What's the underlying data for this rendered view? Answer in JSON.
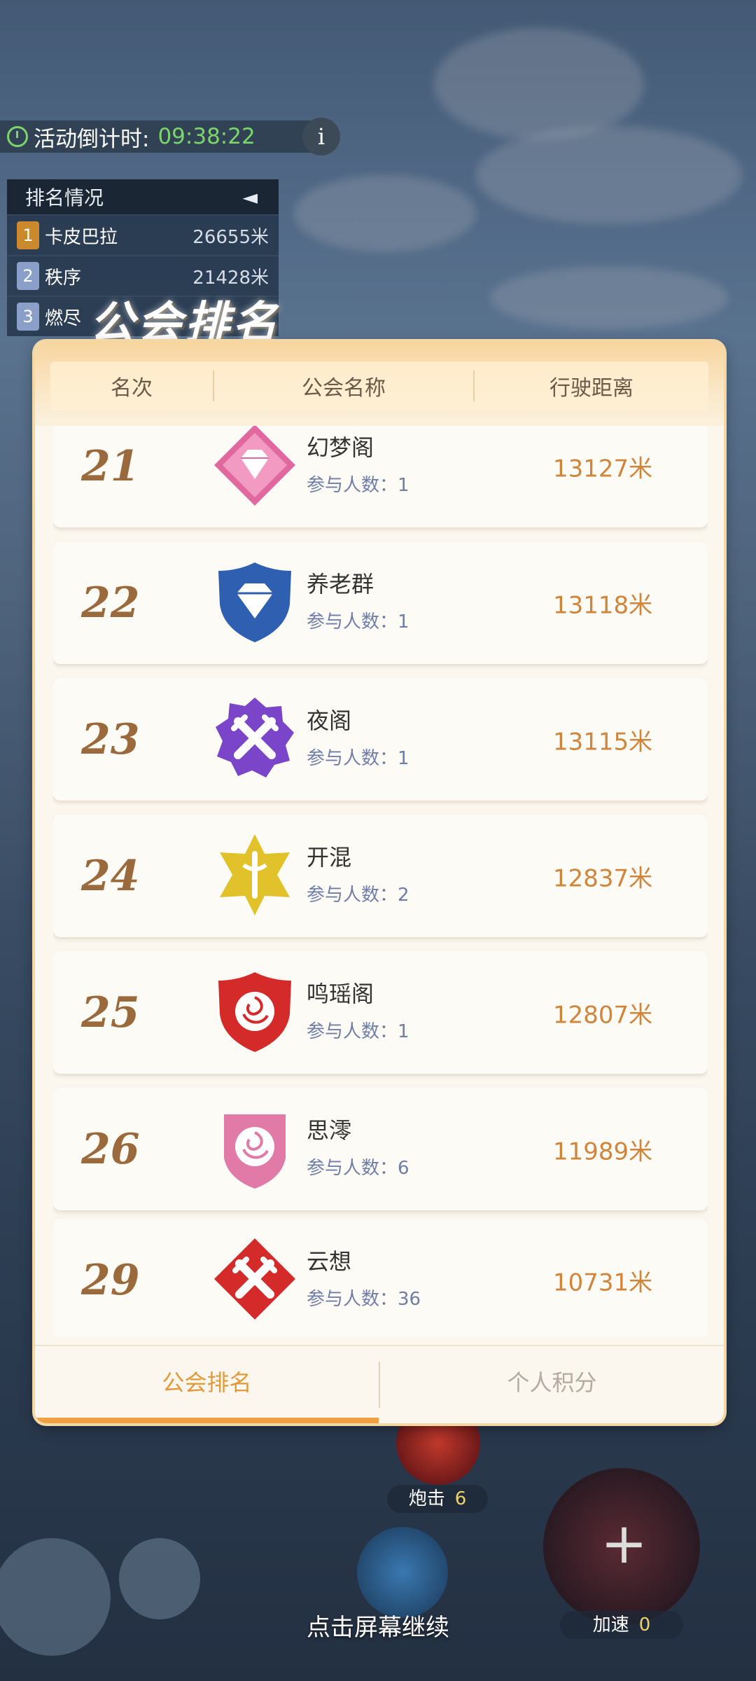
{
  "hud": {
    "countdown_label": "活动倒计时:",
    "countdown_time": "09:38:22",
    "info_glyph": "i",
    "rank_panel_title": "排名情况",
    "rank_panel_toggle": "◄",
    "rank_rows": [
      {
        "num": "1",
        "name": "卡皮巴拉",
        "dist": "26655米"
      },
      {
        "num": "2",
        "name": "秩序",
        "dist": "21428米"
      },
      {
        "num": "3",
        "name": "燃尽",
        "dist": ""
      }
    ]
  },
  "panel": {
    "title": "公会排名",
    "columns": [
      "名次",
      "公会名称",
      "行驶距离"
    ],
    "members_prefix": "参与人数：",
    "rows": [
      {
        "rank": "21",
        "name": "幻梦阁",
        "members": "1",
        "distance": "13127米",
        "badge_icon": "pink-diamond-badge",
        "badge_color": "#e06aa0"
      },
      {
        "rank": "22",
        "name": "养老群",
        "members": "1",
        "distance": "13118米",
        "badge_icon": "blue-shield-diamond-badge",
        "badge_color": "#2f5fb0"
      },
      {
        "rank": "23",
        "name": "夜阁",
        "members": "1",
        "distance": "13115米",
        "badge_icon": "purple-crossed-swords-badge",
        "badge_color": "#7a45c8"
      },
      {
        "rank": "24",
        "name": "开混",
        "members": "2",
        "distance": "12837米",
        "badge_icon": "gold-star-sword-badge",
        "badge_color": "#e2c22a"
      },
      {
        "rank": "25",
        "name": "鸣瑶阁",
        "members": "1",
        "distance": "12807米",
        "badge_icon": "red-rose-shield-badge",
        "badge_color": "#d42a2a"
      },
      {
        "rank": "26",
        "name": "思澪",
        "members": "6",
        "distance": "11989米",
        "badge_icon": "pink-rose-badge",
        "badge_color": "#e27aa8"
      },
      {
        "rank": "29",
        "name": "云想",
        "members": "36",
        "distance": "10731米",
        "badge_icon": "red-crossed-swords-badge",
        "badge_color": "#d42a2a"
      }
    ],
    "tabs": [
      {
        "label": "公会排名",
        "active": true
      },
      {
        "label": "个人积分",
        "active": false
      }
    ]
  },
  "bottom": {
    "skill1_label": "炮击",
    "skill1_count": "6",
    "skill2_label": "加速",
    "skill2_count": "0",
    "plus_glyph": "+",
    "continue_hint": "点击屏幕继续"
  },
  "colors": {
    "accent": "#e09a3a",
    "distance": "#d0853a",
    "rank_text": "#9a6a3c",
    "countdown": "#7bd66a"
  }
}
